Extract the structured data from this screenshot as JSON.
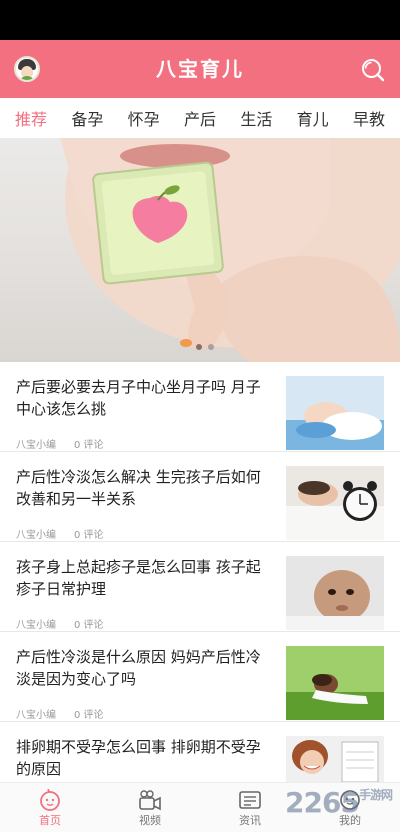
{
  "app": {
    "title": "八宝育儿"
  },
  "header": {
    "avatar_icon": "user-avatar-icon",
    "search_icon": "search-icon"
  },
  "tabs": [
    {
      "label": "推荐",
      "active": true
    },
    {
      "label": "备孕",
      "active": false
    },
    {
      "label": "怀孕",
      "active": false
    },
    {
      "label": "产后",
      "active": false
    },
    {
      "label": "生活",
      "active": false
    },
    {
      "label": "育儿",
      "active": false
    },
    {
      "label": "早教",
      "active": false
    }
  ],
  "carousel": {
    "slide_count": 2,
    "active_index": 1
  },
  "articles": [
    {
      "title": "产后要必要去月子中心坐月子吗 月子中心该怎么挑",
      "author": "八宝小编",
      "comments": "0 评论"
    },
    {
      "title": "产后性冷淡怎么解决 生完孩子后如何改善和另一半关系",
      "author": "八宝小编",
      "comments": "0 评论"
    },
    {
      "title": "孩子身上总起疹子是怎么回事 孩子起疹子日常护理",
      "author": "八宝小编",
      "comments": "0 评论"
    },
    {
      "title": "产后性冷淡是什么原因 妈妈产后性冷淡是因为变心了吗",
      "author": "八宝小编",
      "comments": "0 评论"
    },
    {
      "title": "排卵期不受孕怎么回事 排卵期不受孕的原因",
      "author": "",
      "comments": ""
    }
  ],
  "bottom_nav": [
    {
      "label": "首页",
      "icon": "baby-face-icon",
      "active": true
    },
    {
      "label": "视频",
      "icon": "video-camera-icon",
      "active": false
    },
    {
      "label": "资讯",
      "icon": "news-icon",
      "active": false
    },
    {
      "label": "我的",
      "icon": "profile-icon",
      "active": false
    }
  ],
  "watermark": {
    "text": "2265",
    "suffix": "手游网"
  },
  "colors": {
    "brand": "#f2707f",
    "text": "#222222",
    "meta": "#999999"
  }
}
